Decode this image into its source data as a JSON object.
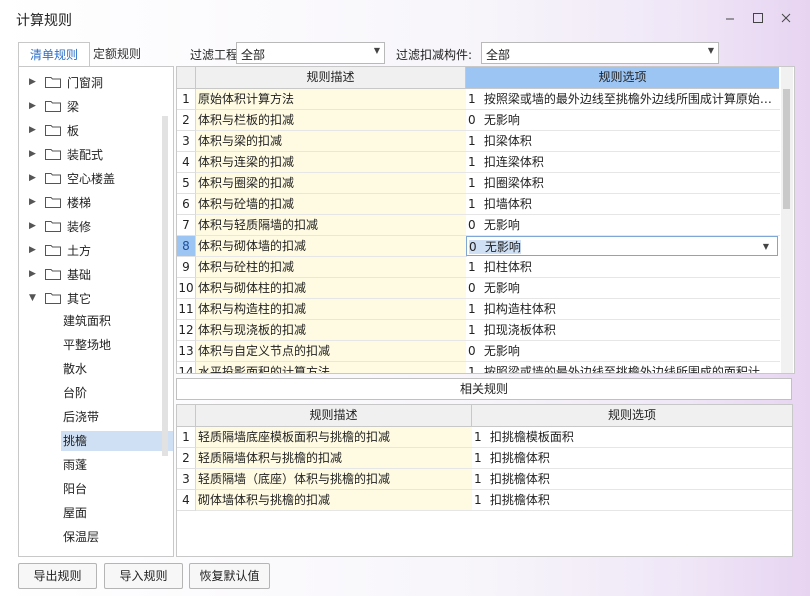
{
  "window": {
    "title": "计算规则"
  },
  "tabs": [
    "清单规则",
    "定额规则"
  ],
  "filters": {
    "project_label": "过滤工程量:",
    "project_value": "全部",
    "component_label": "过滤扣减构件:",
    "component_value": "全部"
  },
  "tree": {
    "folders": [
      "门窗洞",
      "梁",
      "板",
      "装配式",
      "空心楼盖",
      "楼梯",
      "装修",
      "土方",
      "基础",
      "其它"
    ],
    "leaves": [
      "建筑面积",
      "平整场地",
      "散水",
      "台阶",
      "后浇带",
      "挑檐",
      "雨蓬",
      "阳台",
      "屋面",
      "保温层"
    ],
    "selected_leaf": "挑檐"
  },
  "main_table": {
    "headers": [
      "规则描述",
      "规则选项"
    ],
    "rows": [
      {
        "n": "1",
        "desc": "原始体积计算方法",
        "opt_num": "1",
        "opt": "按照梁或墙的最外边线至挑檐外边线所围成计算原始…"
      },
      {
        "n": "2",
        "desc": "体积与栏板的扣减",
        "opt_num": "0",
        "opt": "无影响"
      },
      {
        "n": "3",
        "desc": "体积与梁的扣减",
        "opt_num": "1",
        "opt": "扣梁体积"
      },
      {
        "n": "4",
        "desc": "体积与连梁的扣减",
        "opt_num": "1",
        "opt": "扣连梁体积"
      },
      {
        "n": "5",
        "desc": "体积与圈梁的扣减",
        "opt_num": "1",
        "opt": "扣圈梁体积"
      },
      {
        "n": "6",
        "desc": "体积与砼墙的扣减",
        "opt_num": "1",
        "opt": "扣墙体积"
      },
      {
        "n": "7",
        "desc": "体积与轻质隔墙的扣减",
        "opt_num": "0",
        "opt": "无影响"
      },
      {
        "n": "8",
        "desc": "体积与砌体墙的扣减",
        "opt_num": "0",
        "opt": "无影响"
      },
      {
        "n": "9",
        "desc": "体积与砼柱的扣减",
        "opt_num": "1",
        "opt": "扣柱体积"
      },
      {
        "n": "10",
        "desc": "体积与砌体柱的扣减",
        "opt_num": "0",
        "opt": "无影响"
      },
      {
        "n": "11",
        "desc": "体积与构造柱的扣减",
        "opt_num": "1",
        "opt": "扣构造柱体积"
      },
      {
        "n": "12",
        "desc": "体积与现浇板的扣减",
        "opt_num": "1",
        "opt": "扣现浇板体积"
      },
      {
        "n": "13",
        "desc": "体积与自定义节点的扣减",
        "opt_num": "0",
        "opt": "无影响"
      },
      {
        "n": "14",
        "desc": "水平投影面积的计算方法",
        "opt_num": "1",
        "opt": "按照梁或墙的最外边线至挑檐外边线所围成的面积计…"
      }
    ],
    "selected_row": "8"
  },
  "related_label": "相关规则",
  "related_table": {
    "headers": [
      "规则描述",
      "规则选项"
    ],
    "rows": [
      {
        "n": "1",
        "desc": "轻质隔墙底座模板面积与挑檐的扣减",
        "opt_num": "1",
        "opt": "扣挑檐模板面积"
      },
      {
        "n": "2",
        "desc": "轻质隔墙体积与挑檐的扣减",
        "opt_num": "1",
        "opt": "扣挑檐体积"
      },
      {
        "n": "3",
        "desc": "轻质隔墙（底座）体积与挑檐的扣减",
        "opt_num": "1",
        "opt": "扣挑檐体积"
      },
      {
        "n": "4",
        "desc": "砌体墙体积与挑檐的扣减",
        "opt_num": "1",
        "opt": "扣挑檐体积"
      }
    ]
  },
  "buttons": {
    "export": "导出规则",
    "import": "导入规则",
    "restore": "恢复默认值"
  },
  "colors": {
    "accent": "#2a6fc9",
    "header_selected": "#9cc5f3",
    "desc_cell": "#fffbe3",
    "selection": "#cfe0f5"
  }
}
